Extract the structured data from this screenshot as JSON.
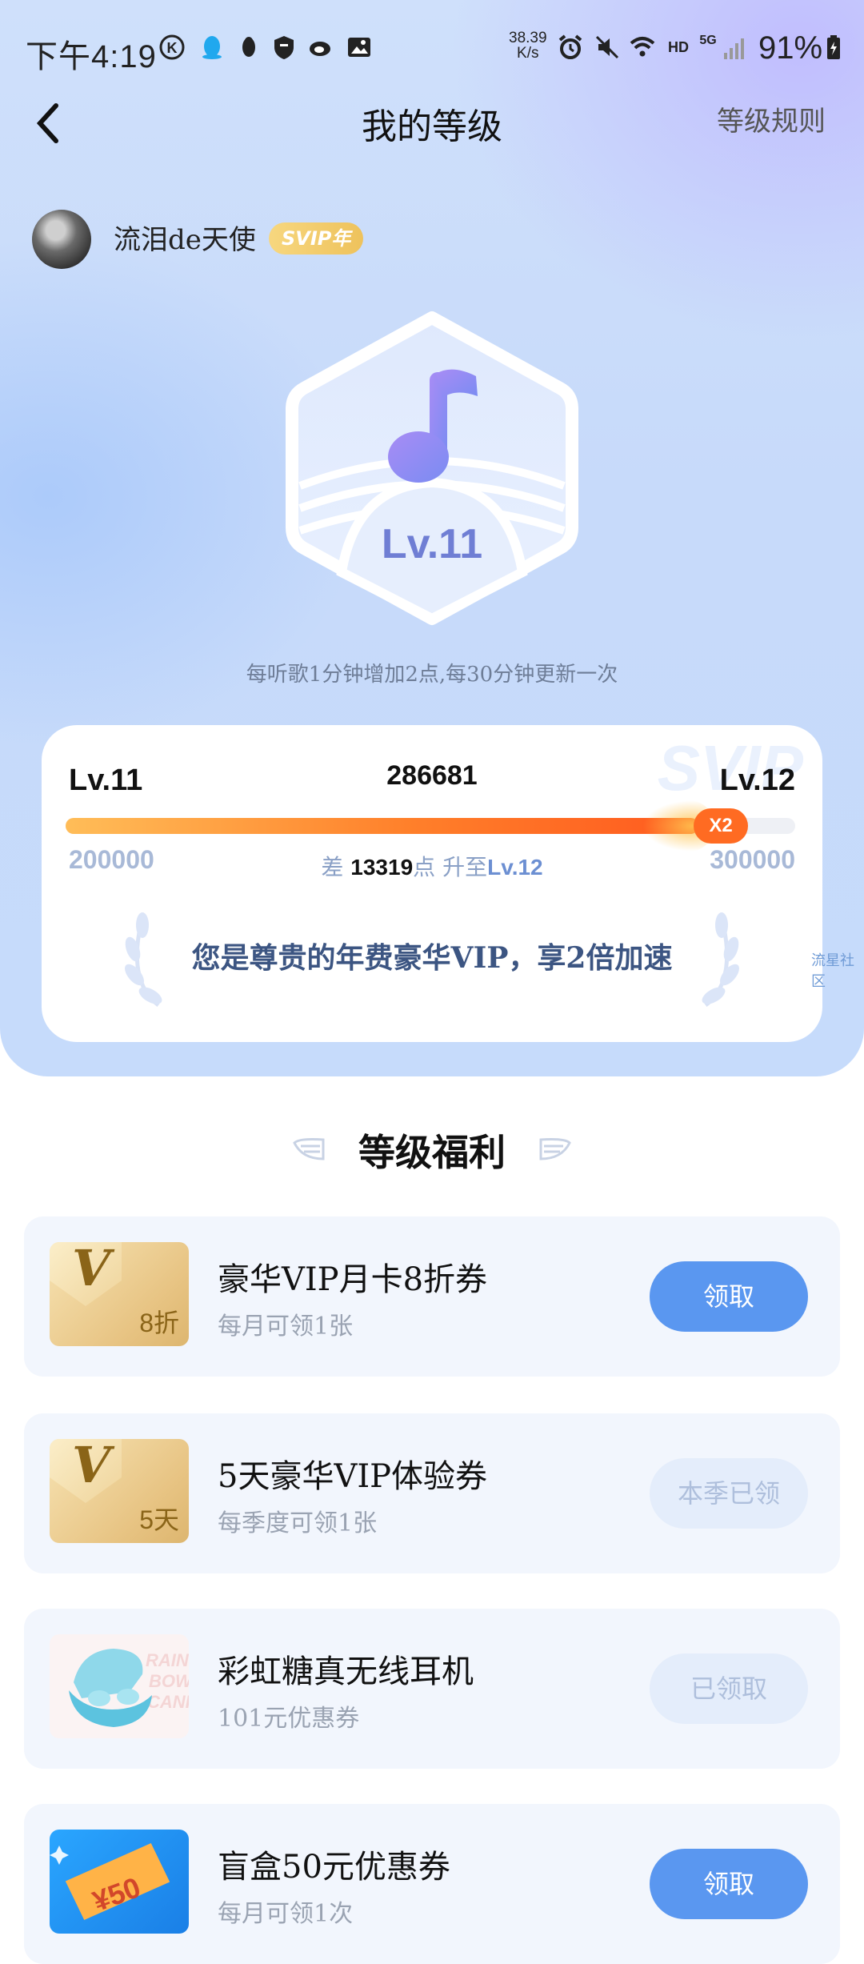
{
  "status_bar": {
    "time": "下午4:19",
    "net_speed": "38.39",
    "net_unit": "K/s",
    "hd": "HD",
    "signal": "5G",
    "battery": "91%"
  },
  "header": {
    "title": "我的等级",
    "rules_link": "等级规则"
  },
  "user": {
    "name": "流泪de天使",
    "badge": "SVIP年"
  },
  "level": {
    "current_label": "Lv.11",
    "hint": "每听歌1分钟增加2点,每30分钟更新一次"
  },
  "progress_card": {
    "watermark": "SVIP",
    "left_level": "Lv.11",
    "right_level": "Lv.12",
    "points": "286681",
    "min": "200000",
    "max": "300000",
    "progress_fraction": 0.867,
    "multiplier": "X2",
    "gap_prefix": "差",
    "gap_value": "13319",
    "gap_mid": "点",
    "gap_up": "升至",
    "gap_target": "Lv.12",
    "vip_message": "您是尊贵的年费豪华VIP，享2倍加速"
  },
  "side_watermark": "流星社区",
  "benefits": {
    "title": "等级福利",
    "items": [
      {
        "name": "豪华VIP月卡8折券",
        "desc": "每月可领1张",
        "tag": "8折",
        "button": "领取",
        "thumb_letter": "V"
      },
      {
        "name": "5天豪华VIP体验券",
        "desc": "每季度可领1张",
        "tag": "5天",
        "button": "本季已领",
        "thumb_letter": "V"
      },
      {
        "name": "彩虹糖真无线耳机",
        "desc": "101元优惠券",
        "button": "已领取"
      },
      {
        "name": "盲盒50元优惠券",
        "desc": "每月可领1次",
        "tag": "¥50",
        "button": "领取"
      }
    ]
  }
}
